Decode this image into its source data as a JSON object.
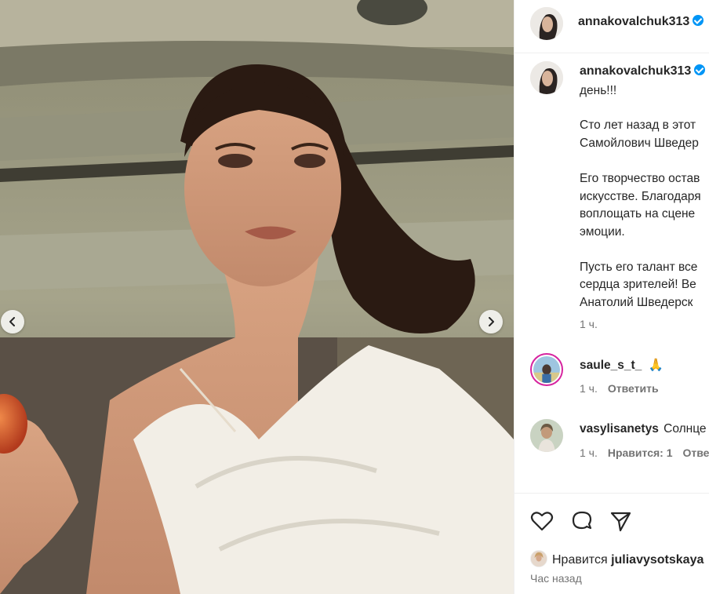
{
  "post": {
    "author": "annakovalchuk313",
    "caption_lines": [
      "день!!!",
      "",
      "Сто лет назад в этот",
      "Самойлович Шведер",
      "",
      "Его творчество остав",
      "искусстве. Благодаря",
      "воплощать на сцене",
      "эмоции.",
      "",
      "Пусть его талант все",
      "сердца зрителей! Ве",
      "Анатолий Шведерск"
    ],
    "caption_time": "1 ч."
  },
  "comments": [
    {
      "user": "saule_s_t_",
      "text": "🙏",
      "time": "1 ч.",
      "reply_label": "Ответить"
    },
    {
      "user": "vasylisanetys",
      "text": "Солнце",
      "time": "1 ч.",
      "likes_label": "Нравится: 1",
      "reply_label": "Отве"
    }
  ],
  "footer": {
    "likes_prefix": "Нравится",
    "likes_user": "juliavysotskaya",
    "time": "Час назад"
  },
  "colors": {
    "verified": "#0095f6",
    "muted": "#737373",
    "text": "#262626"
  },
  "icons": [
    "chevron-left-icon",
    "chevron-right-icon",
    "heart-icon",
    "comment-icon",
    "share-icon",
    "verified-icon"
  ]
}
